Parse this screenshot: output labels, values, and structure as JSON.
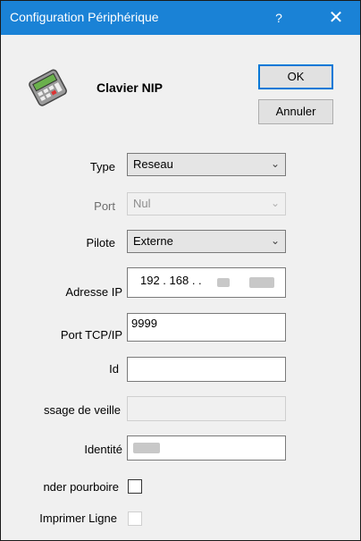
{
  "window": {
    "title": "Configuration Périphérique",
    "help_glyph": "?",
    "close_glyph": "✕"
  },
  "device": {
    "name": "Clavier NIP",
    "icon": "pinpad-icon"
  },
  "buttons": {
    "ok": "OK",
    "cancel": "Annuler"
  },
  "form": {
    "type": {
      "label": "Type",
      "value": "Reseau"
    },
    "port": {
      "label": "Port",
      "value": "Nul"
    },
    "pilote": {
      "label": "Pilote",
      "value": "Externe"
    },
    "ip": {
      "label": "Adresse IP",
      "value": "192 . 168 .     .    "
    },
    "tcp_port": {
      "label": "Port TCP/IP",
      "value": "9999"
    },
    "id": {
      "label": "Id",
      "value": ""
    },
    "sleep_msg": {
      "label": "ssage de veille",
      "value": ""
    },
    "identity": {
      "label": "Identité",
      "value": ""
    },
    "ask_tip": {
      "label": "nder pourboire",
      "checked": false
    },
    "print_line": {
      "label": "Imprimer Ligne",
      "checked": false
    }
  },
  "dropdown_arrow": "⌄"
}
